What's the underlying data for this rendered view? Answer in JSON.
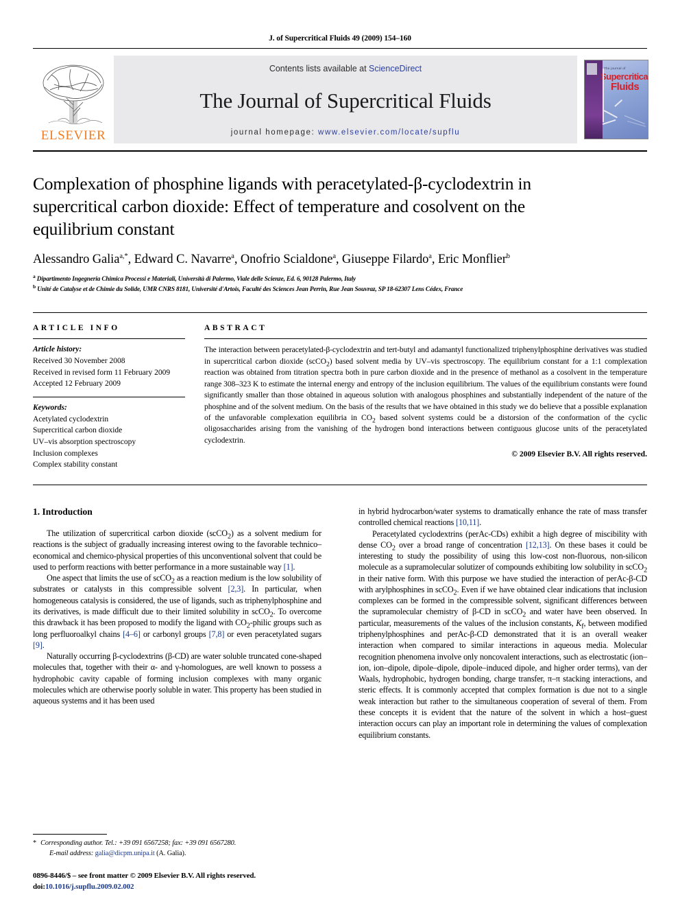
{
  "running_head": "J. of Supercritical Fluids 49 (2009) 154–160",
  "masthead": {
    "contents_prefix": "Contents lists available at ",
    "sciencedirect": "ScienceDirect",
    "journal_title": "The Journal of Supercritical Fluids",
    "homepage_prefix": "journal homepage: ",
    "homepage_url": "www.elsevier.com/locate/supflu",
    "publisher_logo_text": "ELSEVIER",
    "cover": {
      "tagline": "The journal of",
      "line1": "Supercritical",
      "line2": "Fluids"
    }
  },
  "article": {
    "title": "Complexation of phosphine ligands with peracetylated-β-cyclodextrin in supercritical carbon dioxide: Effect of temperature and cosolvent on the equilibrium constant",
    "authors": "Alessandro Galia a,*, Edward C. Navarre a, Onofrio Scialdone a, Giuseppe Filardo a, Eric Monflier b",
    "authors_html": "Alessandro Galia<sup>a,*</sup>, Edward C. Navarre<sup>a</sup>, Onofrio Scialdone<sup>a</sup>, Giuseppe Filardo<sup>a</sup>, Eric Monflier<sup>b</sup>",
    "affiliation_a": "Dipartimento Ingegneria Chimica Processi e Materiali, Università di Palermo, Viale delle Scienze, Ed. 6, 90128 Palermo, Italy",
    "affiliation_b": "Unité de Catalyse et de Chimie du Solide, UMR CNRS 8181, Université d'Artois, Faculté des Sciences Jean Perrin, Rue Jean Souvraz, SP 18-62307 Lens Cédex, France"
  },
  "article_info": {
    "heading": "ARTICLE INFO",
    "history_label": "Article history:",
    "history": [
      "Received 30 November 2008",
      "Received in revised form 11 February 2009",
      "Accepted 12 February 2009"
    ],
    "keywords_label": "Keywords:",
    "keywords": [
      "Acetylated cyclodextrin",
      "Supercritical carbon dioxide",
      "UV–vis absorption spectroscopy",
      "Inclusion complexes",
      "Complex stability constant"
    ]
  },
  "abstract": {
    "heading": "ABSTRACT",
    "text_html": "The interaction between peracetylated-β-cyclodextrin and tert-butyl and adamantyl functionalized triphenylphosphine derivatives was studied in supercritical carbon dioxide (scCO<sub>2</sub>) based solvent media by UV–vis spectroscopy. The equilibrium constant for a 1:1 complexation reaction was obtained from titration spectra both in pure carbon dioxide and in the presence of methanol as a cosolvent in the temperature range 308–323 K to estimate the internal energy and entropy of the inclusion equilibrium. The values of the equilibrium constants were found significantly smaller than those obtained in aqueous solution with analogous phosphines and substantially independent of the nature of the phosphine and of the solvent medium. On the basis of the results that we have obtained in this study we do believe that a possible explanation of the unfavorable complexation equilibria in CO<sub>2</sub> based solvent systems could be a distorsion of the conformation of the cyclic oligosaccharides arising from the vanishing of the hydrogen bond interactions between contiguous glucose units of the peracetylated cyclodextrin.",
    "copyright": "© 2009 Elsevier B.V. All rights reserved."
  },
  "body": {
    "section_number_title": "1. Introduction",
    "left_paragraphs_html": [
      "The utilization of supercritical carbon dioxide (scCO<sub>2</sub>) as a solvent medium for reactions is the subject of gradually increasing interest owing to the favorable technico–economical and chemico-physical properties of this unconventional solvent that could be used to perform reactions with better performance in a more sustainable way <span class=\"ref\">[1]</span>.",
      "One aspect that limits the use of scCO<sub>2</sub> as a reaction medium is the low solubility of substrates or catalysts in this compressible solvent <span class=\"ref\">[2,3]</span>. In particular, when homogeneous catalysis is considered, the use of ligands, such as triphenylphosphine and its derivatives, is made difficult due to their limited solubility in scCO<sub>2</sub>. To overcome this drawback it has been proposed to modify the ligand with CO<sub>2</sub>-philic groups such as long perfluoroalkyl chains <span class=\"ref\">[4–6]</span> or carbonyl groups <span class=\"ref\">[7,8]</span> or even peracetylated sugars <span class=\"ref\">[9]</span>.",
      "Naturally occurring β-cyclodextrins (β-CD) are water soluble truncated cone-shaped molecules that, together with their α- and γ-homologues, are well known to possess a hydrophobic cavity capable of forming inclusion complexes with many organic molecules which are otherwise poorly soluble in water. This property has been studied in aqueous systems and it has been used"
    ],
    "right_paragraphs_html": [
      "in hybrid hydrocarbon/water systems to dramatically enhance the rate of mass transfer controlled chemical reactions <span class=\"ref\">[10,11]</span>.",
      "Peracetylated cyclodextrins (perAc-CDs) exhibit a high degree of miscibility with dense CO<sub>2</sub> over a broad range of concentration <span class=\"ref\">[12,13]</span>. On these bases it could be interesting to study the possibility of using this low-cost non-fluorous, non-silicon molecule as a supramolecular solutizer of compounds exhibiting low solubility in scCO<sub>2</sub> in their native form. With this purpose we have studied the interaction of perAc-β-CD with arylphosphines in scCO<sub>2</sub>. Even if we have obtained clear indications that inclusion complexes can be formed in the compressible solvent, significant differences between the supramolecular chemistry of β-CD in scCO<sub>2</sub> and water have been observed. In particular, measurements of the values of the inclusion constants, <span class=\"ital\">K</span><sub>f</sub>, between modified triphenylphosphines and perAc-β-CD demonstrated that it is an overall weaker interaction when compared to similar interactions in aqueous media. Molecular recognition phenomena involve only noncovalent interactions, such as electrostatic (ion–ion, ion–dipole, dipole–dipole, dipole–induced dipole, and higher order terms), van der Waals, hydrophobic, hydrogen bonding, charge transfer, π–π stacking interactions, and steric effects. It is commonly accepted that complex formation is due not to a single weak interaction but rather to the simultaneous cooperation of several of them. From these concepts it is evident that the nature of the solvent in which a host–guest interaction occurs can play an important role in determining the values of complexation equilibrium constants."
    ]
  },
  "footer": {
    "corresponding_html": "<em>Corresponding author. Tel.: +39 091 6567258; fax: +39 091 6567280.</em>",
    "corresponding_text": "Corresponding author. Tel.: +39 091 6567258; fax: +39 091 6567280.",
    "email_label": "E-mail address:",
    "email": "galia@dicpm.unipa.it",
    "email_owner": "(A. Galia).",
    "issn_line": "0896-8446/$ – see front matter © 2009 Elsevier B.V. All rights reserved.",
    "doi_label": "doi:",
    "doi": "10.1016/j.supflu.2009.02.002"
  },
  "colors": {
    "elsevier_orange": "#F07E26",
    "link_blue": "#1b3a8c",
    "masthead_grey": "#e9e9ec",
    "cover_red": "#d81f26"
  }
}
